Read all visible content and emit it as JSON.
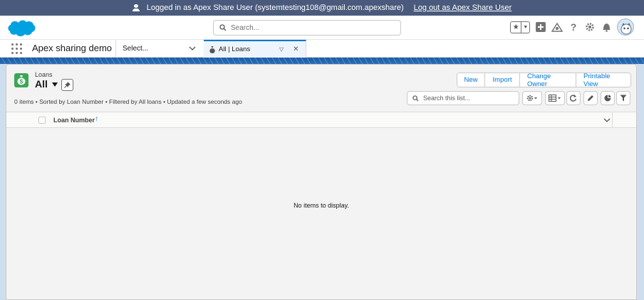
{
  "banner": {
    "text": "Logged in as Apex Share User (systemtesting108@gmail.com.apexshare)",
    "logout_label": "Log out as Apex Share User"
  },
  "global_header": {
    "search_placeholder": "Search..."
  },
  "nav": {
    "app_name": "Apex sharing demo",
    "select_label": "Select...",
    "tab_label": "All | Loans"
  },
  "list_view": {
    "object_label": "Loans",
    "view_name": "All",
    "subtitle": "0 items • Sorted by Loan Number • Filtered by All loans • Updated a few seconds ago",
    "buttons": [
      "New",
      "Import",
      "Change Owner",
      "Printable View"
    ],
    "search_placeholder": "Search this list...",
    "columns": [
      {
        "label": "Loan Number",
        "sort": "ascending"
      }
    ],
    "empty_message": "No items to display."
  },
  "colors": {
    "banner": "#4a5a7c",
    "brand_blue": "#0176d3",
    "object_icon": "#3ba755"
  }
}
